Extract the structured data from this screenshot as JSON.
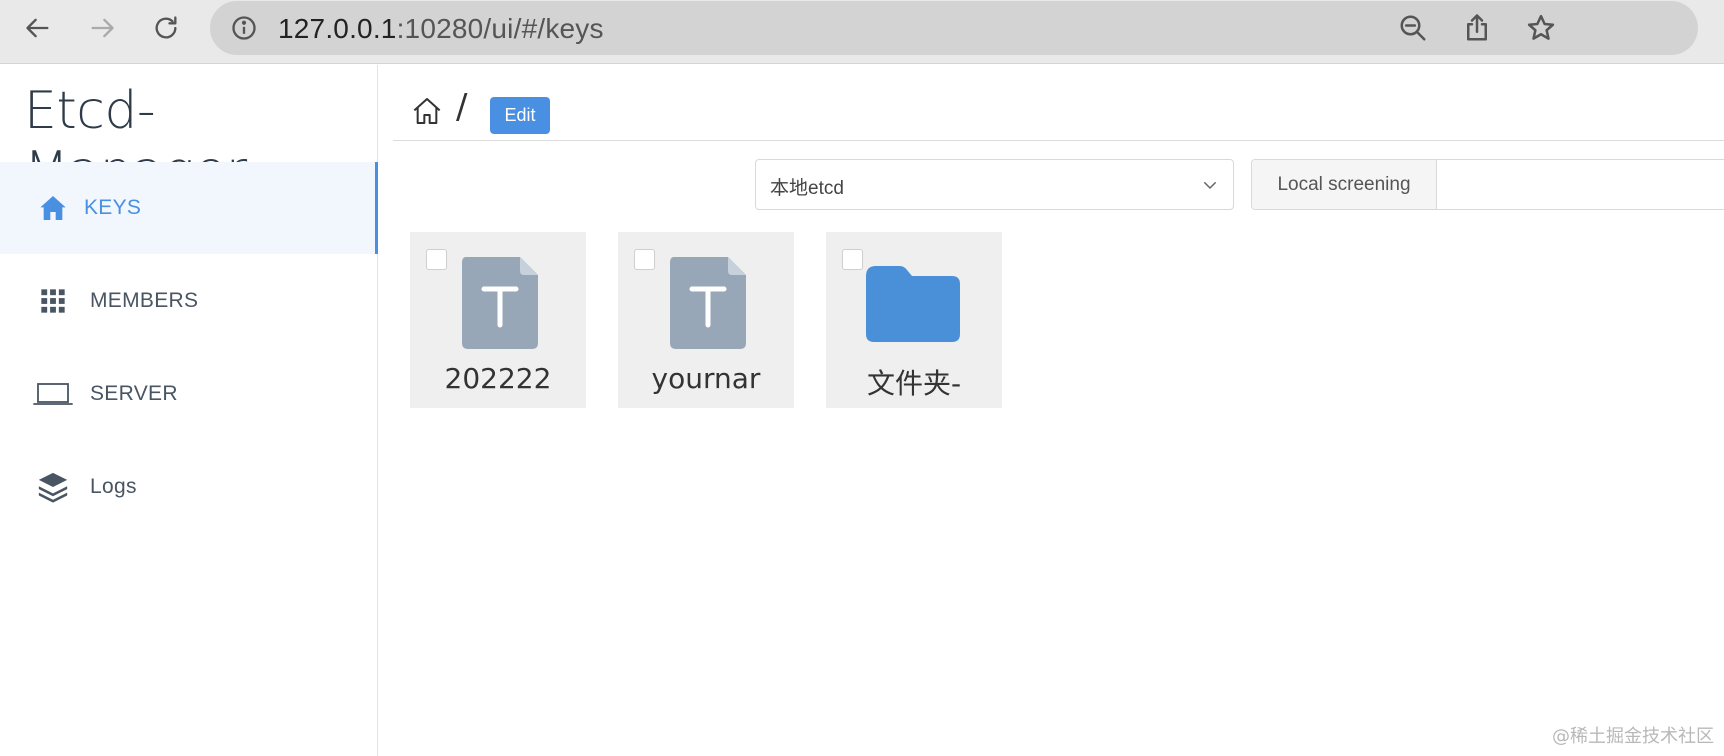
{
  "browser": {
    "url_host": "127.0.0.1",
    "url_rest": ":10280/ui/#/keys",
    "back_icon": "arrow-left-icon",
    "forward_icon": "arrow-right-icon",
    "reload_icon": "reload-icon",
    "info_icon": "info-icon",
    "zoom_icon": "zoom-out-icon",
    "share_icon": "share-icon",
    "bookmark_icon": "star-icon"
  },
  "sidebar": {
    "brand": "Etcd-Manager",
    "items": [
      {
        "label": "KEYS",
        "icon": "home-icon",
        "active": true
      },
      {
        "label": "MEMBERS",
        "icon": "grid-icon",
        "active": false
      },
      {
        "label": "SERVER",
        "icon": "laptop-icon",
        "active": false
      },
      {
        "label": "Logs",
        "icon": "layers-icon",
        "active": false
      }
    ]
  },
  "main": {
    "breadcrumb_separator": "/",
    "edit_label": "Edit",
    "server_select": {
      "value": "本地etcd"
    },
    "filter": {
      "addon_label": "Local screening",
      "value": "",
      "placeholder": ""
    },
    "keys": [
      {
        "name": "202222",
        "type": "text"
      },
      {
        "name": "yournar",
        "type": "text"
      },
      {
        "name": "文件夹-",
        "type": "folder"
      }
    ]
  },
  "watermark": "@稀土掘金技术社区",
  "colors": {
    "accent": "#4a90e2",
    "folder": "#4a90d9",
    "file": "#97a7b8",
    "card": "#efefef"
  }
}
